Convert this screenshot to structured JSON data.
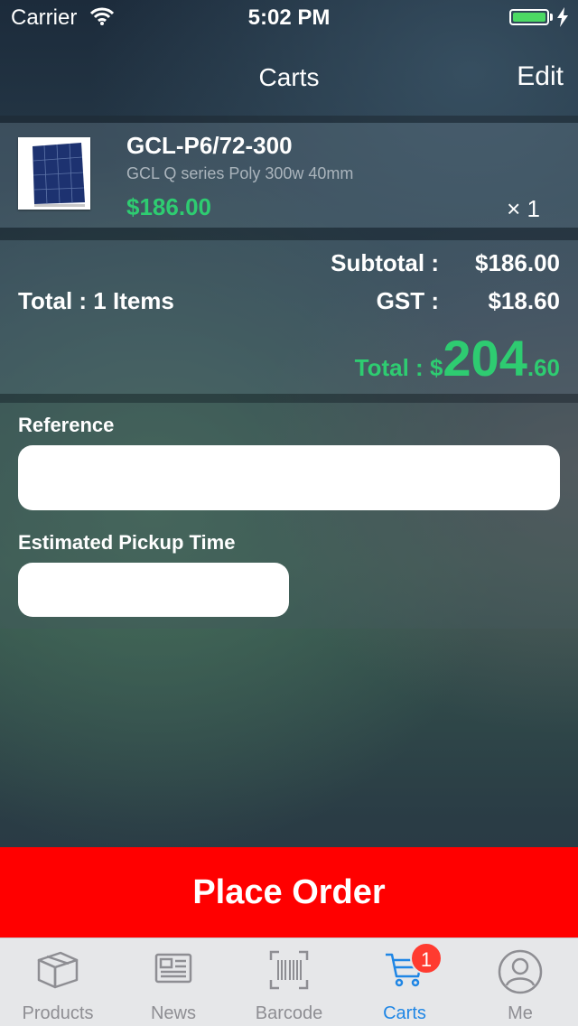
{
  "status_bar": {
    "carrier": "Carrier",
    "time": "5:02 PM"
  },
  "nav": {
    "title": "Carts",
    "edit_label": "Edit"
  },
  "cart_item": {
    "name": "GCL-P6/72-300",
    "description": "GCL Q series Poly 300w 40mm",
    "price": "$186.00",
    "quantity": "× 1"
  },
  "totals": {
    "items_label": "Total : 1  Items",
    "subtotal_label": "Subtotal :",
    "subtotal_value": "$186.00",
    "gst_label": "GST :",
    "gst_value": "$18.60",
    "grand_label": "Total : $",
    "grand_int": "204",
    "grand_dec": ".60"
  },
  "form": {
    "reference_label": "Reference",
    "reference_value": "",
    "pickup_label": "Estimated Pickup Time",
    "pickup_value": ""
  },
  "place_order_label": "Place Order",
  "tabs": [
    {
      "label": "Products",
      "icon": "box-icon"
    },
    {
      "label": "News",
      "icon": "newspaper-icon"
    },
    {
      "label": "Barcode",
      "icon": "barcode-icon"
    },
    {
      "label": "Carts",
      "icon": "cart-icon",
      "badge": "1",
      "active": true
    },
    {
      "label": "Me",
      "icon": "user-icon"
    }
  ],
  "colors": {
    "accent_green": "#2ecc71",
    "place_order_red": "#ff0000",
    "tab_active": "#1f86e5",
    "badge_red": "#ff3b30"
  }
}
